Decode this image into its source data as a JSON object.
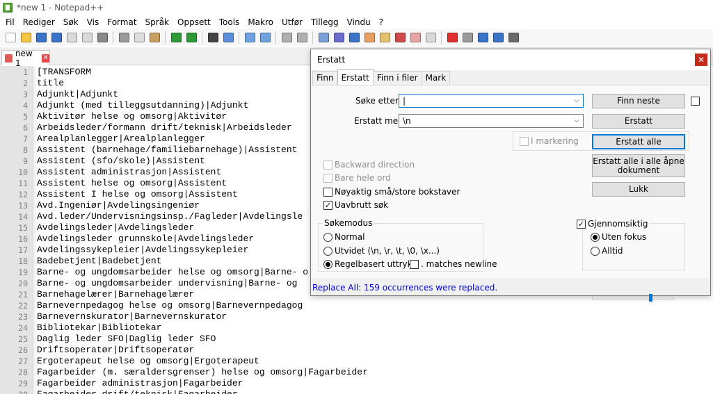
{
  "window": {
    "title": "*new 1 - Notepad++"
  },
  "menu": [
    "Fil",
    "Rediger",
    "Søk",
    "Vis",
    "Format",
    "Språk",
    "Oppsett",
    "Tools",
    "Makro",
    "Utfør",
    "Tillegg",
    "Vindu",
    "?"
  ],
  "toolbar_icons": [
    {
      "name": "new-file-icon",
      "color": "#ffffff"
    },
    {
      "name": "open-file-icon",
      "color": "#f4c542"
    },
    {
      "name": "save-icon",
      "color": "#3a74c9"
    },
    {
      "name": "save-all-icon",
      "color": "#3a74c9"
    },
    {
      "name": "close-icon",
      "color": "#d9d9d9"
    },
    {
      "name": "close-all-icon",
      "color": "#d9d9d9"
    },
    {
      "name": "print-icon",
      "color": "#888888"
    },
    {
      "sep": true
    },
    {
      "name": "cut-icon",
      "color": "#9a9a9a"
    },
    {
      "name": "copy-icon",
      "color": "#dddddd"
    },
    {
      "name": "paste-icon",
      "color": "#c9a060"
    },
    {
      "sep": true
    },
    {
      "name": "undo-icon",
      "color": "#2f9a3a"
    },
    {
      "name": "redo-icon",
      "color": "#2f9a3a"
    },
    {
      "sep": true
    },
    {
      "name": "find-icon",
      "color": "#444444"
    },
    {
      "name": "replace-icon",
      "color": "#5a8ed9"
    },
    {
      "sep": true
    },
    {
      "name": "zoom-in-icon",
      "color": "#6fa3e0"
    },
    {
      "name": "zoom-out-icon",
      "color": "#6fa3e0"
    },
    {
      "sep": true
    },
    {
      "name": "sync-vertical-icon",
      "color": "#b0b0b0"
    },
    {
      "name": "sync-horizontal-icon",
      "color": "#b0b0b0"
    },
    {
      "sep": true
    },
    {
      "name": "word-wrap-icon",
      "color": "#7aa0d8"
    },
    {
      "name": "show-all-chars-icon",
      "color": "#6d6dd0"
    },
    {
      "name": "indent-guide-icon",
      "color": "#3a74c9"
    },
    {
      "name": "user-lang-icon",
      "color": "#e8a060"
    },
    {
      "name": "doc-map-icon",
      "color": "#e6c270"
    },
    {
      "name": "function-list-icon",
      "color": "#d04a4a"
    },
    {
      "name": "folder-workspace-icon",
      "color": "#e6a5a5"
    },
    {
      "name": "monitor-icon",
      "color": "#d9d9d9"
    },
    {
      "sep": true
    },
    {
      "name": "record-macro-icon",
      "color": "#e03030"
    },
    {
      "name": "stop-record-icon",
      "color": "#9a9a9a"
    },
    {
      "name": "play-macro-icon",
      "color": "#3a74c9"
    },
    {
      "name": "run-macro-multiple-icon",
      "color": "#3a74c9"
    },
    {
      "name": "save-macro-icon",
      "color": "#6a6a6a"
    }
  ],
  "tab": {
    "label": "new 1",
    "close": "✕"
  },
  "lines": [
    {
      "n": "1",
      "t": "[TRANSFORM"
    },
    {
      "n": "2",
      "t": "title"
    },
    {
      "n": "3",
      "t": "Adjunkt|Adjunkt"
    },
    {
      "n": "4",
      "t": "Adjunkt (med tilleggsutdanning)|Adjunkt"
    },
    {
      "n": "5",
      "t": "Aktivitør helse og omsorg|Aktivitør"
    },
    {
      "n": "6",
      "t": "Arbeidsleder/formann drift/teknisk|Arbeidsleder"
    },
    {
      "n": "7",
      "t": "Arealplanlegger|Arealplanlegger"
    },
    {
      "n": "8",
      "t": "Assistent (barnehage/familiebarnehage)|Assistent"
    },
    {
      "n": "9",
      "t": "Assistent (sfo/skole)|Assistent"
    },
    {
      "n": "10",
      "t": "Assistent administrasjon|Assistent"
    },
    {
      "n": "11",
      "t": "Assistent helse og omsorg|Assistent"
    },
    {
      "n": "12",
      "t": "Assistent I helse og omsorg|Assistent"
    },
    {
      "n": "13",
      "t": "Avd.Ingeniør|Avdelingsingeniør"
    },
    {
      "n": "14",
      "t": "Avd.leder/Undervisningsinsp./Fagleder|Avdelingsle"
    },
    {
      "n": "15",
      "t": "Avdelingsleder|Avdelingsleder"
    },
    {
      "n": "16",
      "t": "Avdelingsleder grunnskole|Avdelingsleder"
    },
    {
      "n": "17",
      "t": "Avdelingssykepleier|Avdelingssykepleier"
    },
    {
      "n": "18",
      "t": "Badebetjent|Badebetjent"
    },
    {
      "n": "19",
      "t": "Barne- og ungdomsarbeider helse og omsorg|Barne- o"
    },
    {
      "n": "20",
      "t": "Barne- og ungdomsarbeider undervisning|Barne- og"
    },
    {
      "n": "21",
      "t": "Barnehagelærer|Barnehagelærer"
    },
    {
      "n": "22",
      "t": "Barnevernpedagog helse og omsorg|Barnevernpedagog"
    },
    {
      "n": "23",
      "t": "Barnevernskurator|Barnevernskurator"
    },
    {
      "n": "24",
      "t": "Bibliotekar|Bibliotekar"
    },
    {
      "n": "25",
      "t": "Daglig leder SFO|Daglig leder SFO"
    },
    {
      "n": "26",
      "t": "Driftsoperatør|Driftsoperatør"
    },
    {
      "n": "27",
      "t": "Ergoterapeut helse og omsorg|Ergoterapeut"
    },
    {
      "n": "28",
      "t": "Fagarbeider (m. særaldersgrenser) helse og omsorg|Fagarbeider"
    },
    {
      "n": "29",
      "t": "Fagarbeider administrasjon|Fagarbeider"
    },
    {
      "n": "30",
      "t": "Fagarbeider drift/teknisk|Fagarbeider"
    }
  ],
  "dialog": {
    "title": "Erstatt",
    "close": "✕",
    "tabs": [
      "Finn",
      "Erstatt",
      "Finn i filer",
      "Mark"
    ],
    "find_label": "Søke etter:",
    "find_value": "|",
    "replace_label": "Erstatt med:",
    "replace_value": "\\n",
    "buttons": {
      "find_next": "Finn neste",
      "replace": "Erstatt",
      "replace_all": "Erstatt alle",
      "replace_all_open": "Erstatt alle i alle åpne dokument",
      "close": "Lukk"
    },
    "in_selection": "I markering",
    "options": {
      "backward": "Backward direction",
      "whole_word": "Bare hele ord",
      "match_case": "Nøyaktig små/store bokstaver",
      "wrap": "Uavbrutt søk"
    },
    "search_mode": {
      "title": "Søkemodus",
      "normal": "Normal",
      "extended": "Utvidet (\\n, \\r, \\t, \\0, \\x...)",
      "regex": "Regelbasert uttrykk",
      "dot_newline": ". matches newline"
    },
    "transparency": {
      "title": "Gjennomsiktig",
      "on_lose_focus": "Uten fokus",
      "always": "Alltid",
      "level": 0.7
    },
    "status": "Replace All: 159 occurrences were replaced."
  }
}
